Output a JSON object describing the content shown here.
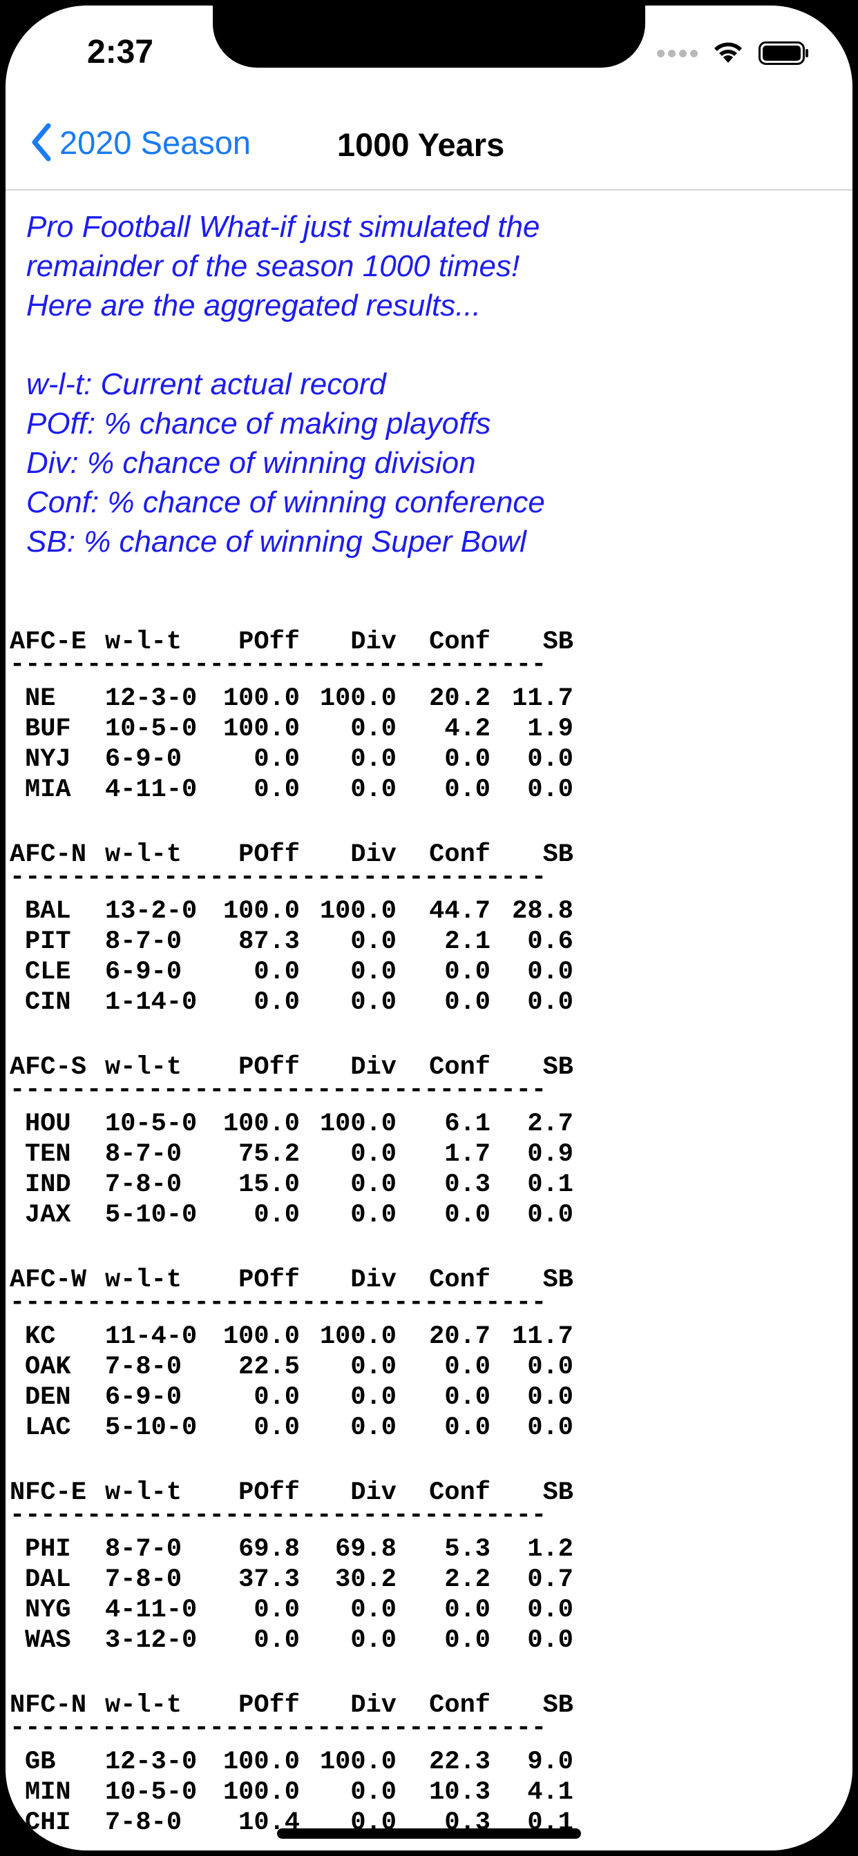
{
  "status_bar": {
    "time": "2:37"
  },
  "nav": {
    "back_label": "2020 Season",
    "title": "1000 Years"
  },
  "intro": {
    "lines": [
      "Pro Football What-if just simulated the",
      "remainder of the season 1000 times!",
      "Here are the aggregated results..."
    ],
    "legend": [
      "w-l-t: Current actual record",
      "POff: % chance of making playoffs",
      "Div: % chance of winning division",
      "Conf: % chance of winning conference",
      "SB: % chance of winning Super Bowl"
    ]
  },
  "columns": {
    "record": "w-l-t",
    "poff": "POff",
    "div": "Div",
    "conf": "Conf",
    "sb": "SB"
  },
  "separator": "-----------------------------------",
  "divisions": [
    {
      "name": "AFC-E",
      "teams": [
        {
          "team": "NE",
          "record": "12-3-0",
          "poff": "100.0",
          "div": "100.0",
          "conf": "20.2",
          "sb": "11.7"
        },
        {
          "team": "BUF",
          "record": "10-5-0",
          "poff": "100.0",
          "div": "0.0",
          "conf": "4.2",
          "sb": "1.9"
        },
        {
          "team": "NYJ",
          "record": "6-9-0",
          "poff": "0.0",
          "div": "0.0",
          "conf": "0.0",
          "sb": "0.0"
        },
        {
          "team": "MIA",
          "record": "4-11-0",
          "poff": "0.0",
          "div": "0.0",
          "conf": "0.0",
          "sb": "0.0"
        }
      ]
    },
    {
      "name": "AFC-N",
      "teams": [
        {
          "team": "BAL",
          "record": "13-2-0",
          "poff": "100.0",
          "div": "100.0",
          "conf": "44.7",
          "sb": "28.8"
        },
        {
          "team": "PIT",
          "record": "8-7-0",
          "poff": "87.3",
          "div": "0.0",
          "conf": "2.1",
          "sb": "0.6"
        },
        {
          "team": "CLE",
          "record": "6-9-0",
          "poff": "0.0",
          "div": "0.0",
          "conf": "0.0",
          "sb": "0.0"
        },
        {
          "team": "CIN",
          "record": "1-14-0",
          "poff": "0.0",
          "div": "0.0",
          "conf": "0.0",
          "sb": "0.0"
        }
      ]
    },
    {
      "name": "AFC-S",
      "teams": [
        {
          "team": "HOU",
          "record": "10-5-0",
          "poff": "100.0",
          "div": "100.0",
          "conf": "6.1",
          "sb": "2.7"
        },
        {
          "team": "TEN",
          "record": "8-7-0",
          "poff": "75.2",
          "div": "0.0",
          "conf": "1.7",
          "sb": "0.9"
        },
        {
          "team": "IND",
          "record": "7-8-0",
          "poff": "15.0",
          "div": "0.0",
          "conf": "0.3",
          "sb": "0.1"
        },
        {
          "team": "JAX",
          "record": "5-10-0",
          "poff": "0.0",
          "div": "0.0",
          "conf": "0.0",
          "sb": "0.0"
        }
      ]
    },
    {
      "name": "AFC-W",
      "teams": [
        {
          "team": "KC",
          "record": "11-4-0",
          "poff": "100.0",
          "div": "100.0",
          "conf": "20.7",
          "sb": "11.7"
        },
        {
          "team": "OAK",
          "record": "7-8-0",
          "poff": "22.5",
          "div": "0.0",
          "conf": "0.0",
          "sb": "0.0"
        },
        {
          "team": "DEN",
          "record": "6-9-0",
          "poff": "0.0",
          "div": "0.0",
          "conf": "0.0",
          "sb": "0.0"
        },
        {
          "team": "LAC",
          "record": "5-10-0",
          "poff": "0.0",
          "div": "0.0",
          "conf": "0.0",
          "sb": "0.0"
        }
      ]
    },
    {
      "name": "NFC-E",
      "teams": [
        {
          "team": "PHI",
          "record": "8-7-0",
          "poff": "69.8",
          "div": "69.8",
          "conf": "5.3",
          "sb": "1.2"
        },
        {
          "team": "DAL",
          "record": "7-8-0",
          "poff": "37.3",
          "div": "30.2",
          "conf": "2.2",
          "sb": "0.7"
        },
        {
          "team": "NYG",
          "record": "4-11-0",
          "poff": "0.0",
          "div": "0.0",
          "conf": "0.0",
          "sb": "0.0"
        },
        {
          "team": "WAS",
          "record": "3-12-0",
          "poff": "0.0",
          "div": "0.0",
          "conf": "0.0",
          "sb": "0.0"
        }
      ]
    },
    {
      "name": "NFC-N",
      "teams": [
        {
          "team": "GB",
          "record": "12-3-0",
          "poff": "100.0",
          "div": "100.0",
          "conf": "22.3",
          "sb": "9.0"
        },
        {
          "team": "MIN",
          "record": "10-5-0",
          "poff": "100.0",
          "div": "0.0",
          "conf": "10.3",
          "sb": "4.1"
        },
        {
          "team": "CHI",
          "record": "7-8-0",
          "poff": "10.4",
          "div": "0.0",
          "conf": "0.3",
          "sb": "0.1"
        }
      ]
    }
  ]
}
